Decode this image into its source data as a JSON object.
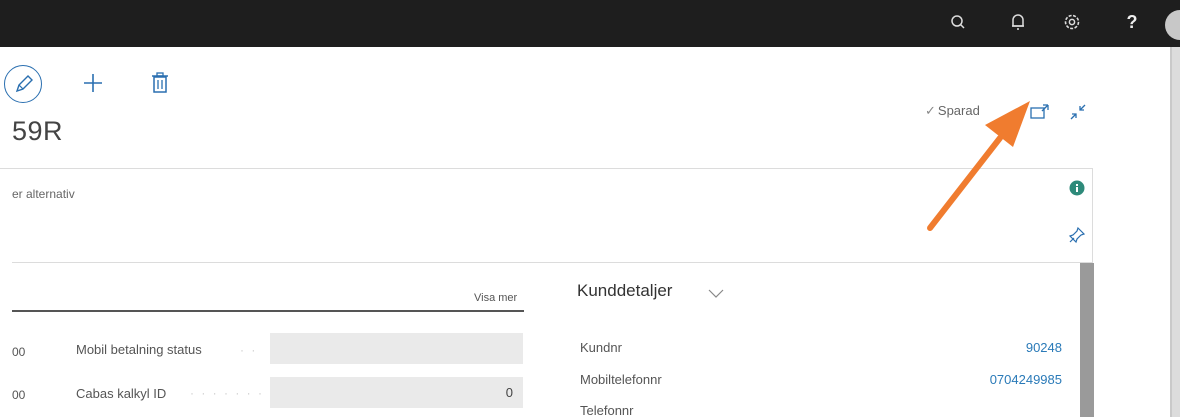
{
  "topbar": {
    "icons": [
      "search-icon",
      "bell-icon",
      "gear-icon",
      "help-icon"
    ],
    "help_label": "?"
  },
  "toolbar": {
    "title": "59R",
    "saved_label": "Sparad",
    "saved_check": "✓"
  },
  "actions": {
    "more_options_partial": "er alternativ"
  },
  "general": {
    "show_more": "Visa mer",
    "fields": [
      {
        "left_fragment": "00",
        "label": "Mobil betalning status",
        "value": ""
      },
      {
        "left_fragment": "00",
        "label": "Cabas kalkyl ID",
        "value": "0"
      }
    ]
  },
  "customer": {
    "title": "Kunddetaljer",
    "fields": [
      {
        "label": "Kundnr",
        "value": "90248"
      },
      {
        "label": "Mobiltelefonnr",
        "value": "0704249985"
      },
      {
        "label": "Telefonnr",
        "value": ""
      }
    ]
  },
  "colors": {
    "topbar": "#1e1e1e",
    "link": "#2a7ab8",
    "accent_arrow": "#f07c2f",
    "info": "#2e8a7a"
  }
}
